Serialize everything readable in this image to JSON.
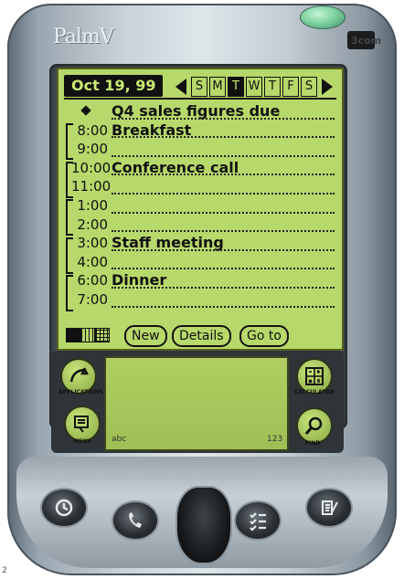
{
  "device": {
    "brand": "PalmV",
    "corner_mark": "3com",
    "stray_digit": "2"
  },
  "header": {
    "date": "Oct 19, 99",
    "weekdays": [
      "S",
      "M",
      "T",
      "W",
      "T",
      "F",
      "S"
    ],
    "selected_day": "T"
  },
  "events": {
    "untimed": "Q4 sales figures due",
    "rows": [
      {
        "time": "8:00",
        "text": "Breakfast"
      },
      {
        "time": "9:00",
        "text": ""
      },
      {
        "time": "10:00",
        "text": "Conference call"
      },
      {
        "time": "11:00",
        "text": ""
      },
      {
        "time": "1:00",
        "text": ""
      },
      {
        "time": "2:00",
        "text": ""
      },
      {
        "time": "3:00",
        "text": "Staff meeting"
      },
      {
        "time": "4:00",
        "text": ""
      },
      {
        "time": "6:00",
        "text": "Dinner"
      },
      {
        "time": "7:00",
        "text": ""
      }
    ]
  },
  "buttons": {
    "new": "New",
    "details": "Details",
    "goto": "Go to"
  },
  "silkscreen": {
    "applications": "APPLICATIONS",
    "menu": "MENU",
    "calculator": "CALCULATOR",
    "find": "FIND",
    "abc": "abc",
    "num": "123"
  },
  "hardware_buttons": [
    "date-book-icon",
    "phone-icon",
    "todo-icon",
    "memo-icon"
  ]
}
